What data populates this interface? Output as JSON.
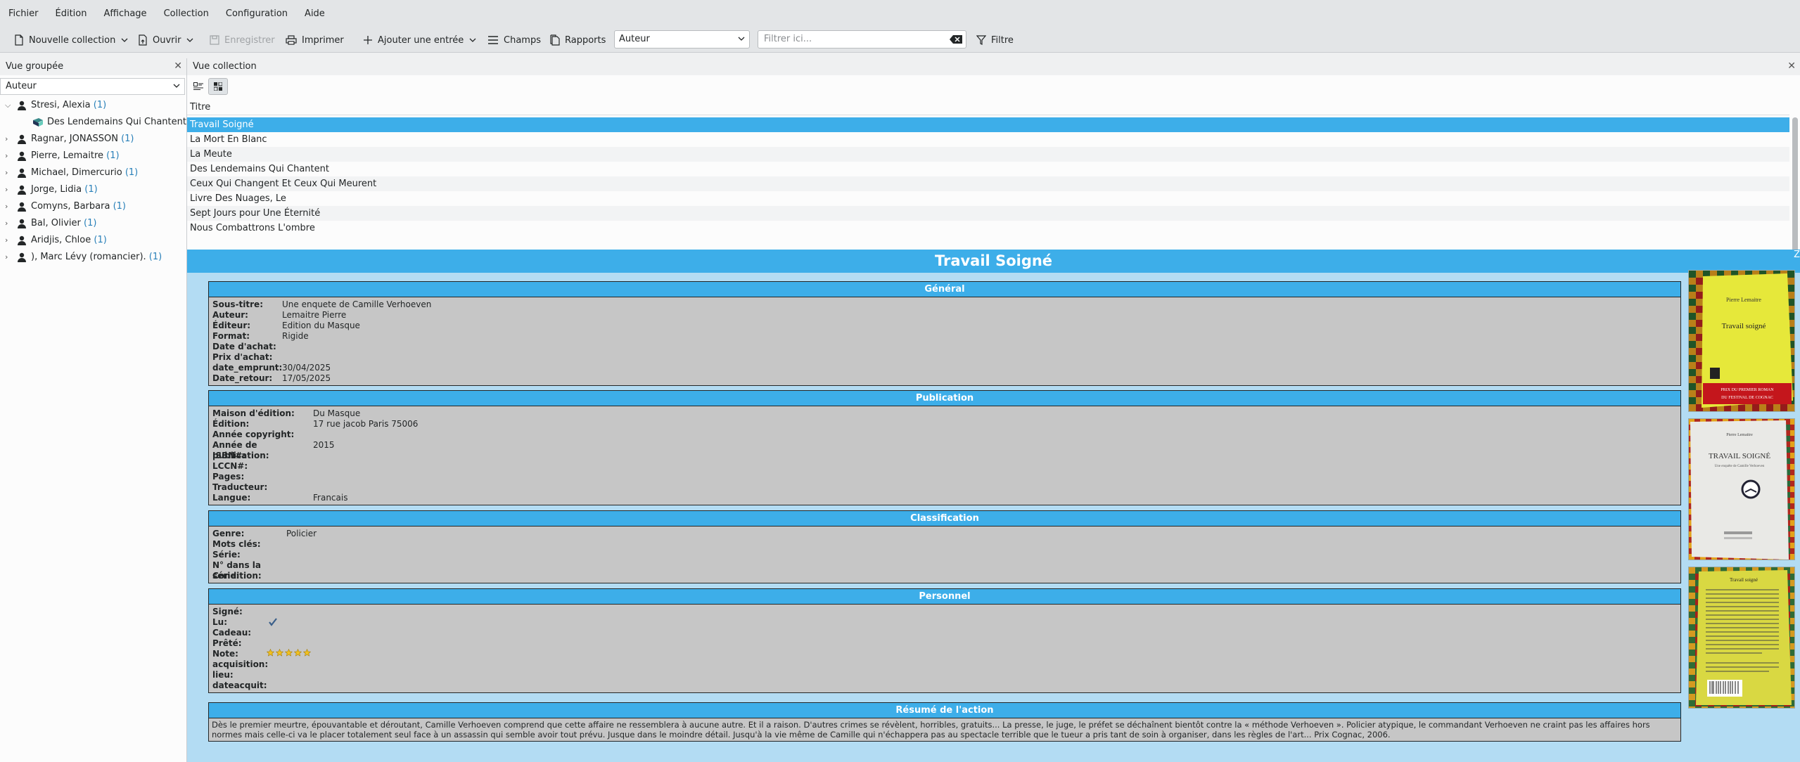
{
  "menu": [
    "Fichier",
    "Édition",
    "Affichage",
    "Collection",
    "Configuration",
    "Aide"
  ],
  "toolbar": {
    "new_collection": "Nouvelle collection",
    "open": "Ouvrir",
    "save": "Enregistrer",
    "print": "Imprimer",
    "add_entry": "Ajouter une entrée",
    "fields": "Champs",
    "reports": "Rapports",
    "field_select": "Auteur",
    "filter_placeholder": "Filtrer ici...",
    "filter": "Filtre"
  },
  "group_view": {
    "title": "Vue groupée",
    "group_by": "Auteur",
    "items": [
      {
        "label": "Stresi, Alexia",
        "count": "(1)",
        "expanded": true,
        "children": [
          "Des Lendemains Qui Chantent"
        ]
      },
      {
        "label": "Ragnar, JONASSON",
        "count": "(1)"
      },
      {
        "label": "Pierre, Lemaitre",
        "count": "(1)"
      },
      {
        "label": "Michael, Dimercurio",
        "count": "(1)"
      },
      {
        "label": "Jorge, Lidia",
        "count": "(1)"
      },
      {
        "label": "Comyns, Barbara",
        "count": "(1)"
      },
      {
        "label": "Bal, Olivier",
        "count": "(1)"
      },
      {
        "label": "Aridjis, Chloe",
        "count": "(1)"
      },
      {
        "label": "), Marc Lévy (romancier).",
        "count": "(1)"
      }
    ]
  },
  "collection_view": {
    "title": "Vue collection",
    "column_header": "Titre",
    "rows": [
      "Travail Soigné",
      "La Mort En Blanc",
      "La Meute",
      "Des Lendemains Qui Chantent",
      "Ceux Qui Changent Et Ceux Qui Meurent",
      "Livre Des Nuages, Le",
      "Sept Jours pour Une Éternité",
      "Nous Combattrons L'ombre"
    ],
    "selected_index": 0
  },
  "detail": {
    "title": "Travail Soigné",
    "corner": "Z",
    "general": {
      "heading": "Général",
      "fields": [
        {
          "label": "Sous-titre:",
          "value": "Une enquete de Camille Verhoeven"
        },
        {
          "label": "Auteur:",
          "value": "Lemaitre Pierre"
        },
        {
          "label": "Éditeur:",
          "value": "Edition du Masque"
        },
        {
          "label": "Format:",
          "value": "Rigide"
        },
        {
          "label": "Date d'achat:",
          "value": ""
        },
        {
          "label": "Prix d'achat:",
          "value": ""
        },
        {
          "label": "date_emprunt:",
          "value": "30/04/2025"
        },
        {
          "label": "Date_retour:",
          "value": "17/05/2025"
        }
      ]
    },
    "publication": {
      "heading": "Publication",
      "fields": [
        {
          "label": "Maison d'édition:",
          "value": "Du Masque"
        },
        {
          "label": "Édition:",
          "value": "17 rue jacob Paris 75006"
        },
        {
          "label": "Année copyright:",
          "value": ""
        },
        {
          "label": "Année de publication:",
          "value": "2015"
        },
        {
          "label": "ISBN#:",
          "value": ""
        },
        {
          "label": "LCCN#:",
          "value": ""
        },
        {
          "label": "Pages:",
          "value": ""
        },
        {
          "label": "Traducteur:",
          "value": ""
        },
        {
          "label": "Langue:",
          "value": "Francais"
        }
      ]
    },
    "classification": {
      "heading": "Classification",
      "fields": [
        {
          "label": "Genre:",
          "value": "Policier"
        },
        {
          "label": "Mots clés:",
          "value": ""
        },
        {
          "label": "Série:",
          "value": ""
        },
        {
          "label": "N° dans la série:",
          "value": ""
        },
        {
          "label": "Condition:",
          "value": ""
        }
      ]
    },
    "personnel": {
      "heading": "Personnel",
      "fields": [
        {
          "label": "Signé:",
          "value": ""
        },
        {
          "label": "Lu:",
          "value": ""
        },
        {
          "label": "Cadeau:",
          "value": ""
        },
        {
          "label": "Prêté:",
          "value": ""
        },
        {
          "label": "Note:",
          "value": ""
        },
        {
          "label": "acquisition:",
          "value": ""
        },
        {
          "label": "lieu:",
          "value": ""
        },
        {
          "label": "dateacquit:",
          "value": ""
        }
      ],
      "read_checked": true,
      "rating": 5,
      "rating_max": 5
    },
    "summary": {
      "heading": "Résumé de l'action",
      "text": "Dès le premier meurtre, épouvantable et déroutant, Camille Verhoeven comprend que cette affaire ne ressemblera à aucune autre. Et il a raison. D'autres crimes se révèlent, horribles, gratuits... La presse, le juge, le préfet se déchaînent bientôt contre la « méthode Verhoeven ». Policier atypique, le commandant Verhoeven ne craint pas les affaires hors normes mais celle-ci va le placer totalement seul face à un assassin qui semble avoir tout prévu. Jusque dans le moindre détail. Jusqu'à la vie même de Camille qui n'échappera pas au spectacle terrible que le tueur a pris tant de soin à organiser, dans les règles de l'art... Prix Cognac, 2006."
    },
    "covers": [
      {
        "author": "Pierre Lemaitre",
        "title": "Travail soigné",
        "band": "PRIX DU PREMIER ROMAN DU FESTIVAL DE COGNAC"
      },
      {
        "author": "Pierre Lemaitre",
        "title": "TRAVAIL SOIGNÉ",
        "subtitle": "Une enquête de Camille Verhoeven"
      },
      {
        "title": "Travail soigné"
      }
    ]
  },
  "colors": {
    "accent": "#3daee9",
    "detail_bg": "#b3dcf3",
    "field_bg": "#c6c6c6",
    "count": "#2980b9"
  }
}
